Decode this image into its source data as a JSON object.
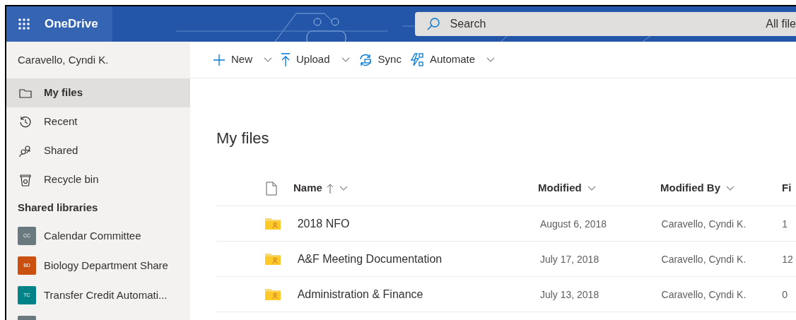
{
  "header": {
    "app_name": "OneDrive",
    "search": {
      "placeholder": "Search",
      "scope": "All file"
    }
  },
  "sidebar": {
    "user": "Caravello, Cyndi K.",
    "items": [
      {
        "label": "My files",
        "kind": "folder",
        "selected": true
      },
      {
        "label": "Recent",
        "kind": "recent",
        "selected": false
      },
      {
        "label": "Shared",
        "kind": "shared",
        "selected": false
      },
      {
        "label": "Recycle bin",
        "kind": "bin",
        "selected": false
      }
    ],
    "section": "Shared libraries",
    "libraries": [
      {
        "initials": "CC",
        "label": "Calendar Committee",
        "color": "#69797e"
      },
      {
        "initials": "BD",
        "label": "Biology Department Share",
        "color": "#ca5010"
      },
      {
        "initials": "TC",
        "label": "Transfer Credit Automati...",
        "color": "#038387"
      },
      {
        "color": "#69797e"
      }
    ]
  },
  "toolbar": [
    {
      "label": "New",
      "kind": "plus",
      "menu": true
    },
    {
      "label": "Upload",
      "kind": "upload",
      "menu": true
    },
    {
      "label": "Sync",
      "kind": "sync",
      "menu": false
    },
    {
      "label": "Automate",
      "kind": "automate",
      "menu": true
    }
  ],
  "title": "My files",
  "table": {
    "columns": [
      {
        "label": "Name",
        "sorted": true
      },
      {
        "label": "Modified",
        "sorted": false
      },
      {
        "label": "Modified By",
        "sorted": false
      },
      {
        "label": "Fi",
        "sorted": false
      }
    ],
    "rows": [
      {
        "name": "2018 NFO",
        "modified": "August 6, 2018",
        "modified_by": "Caravello, Cyndi K.",
        "column_5": "1"
      },
      {
        "name": "A&F Meeting Documentation",
        "modified": "July 17, 2018",
        "modified_by": "Caravello, Cyndi K.",
        "column_5": "12"
      },
      {
        "name": "Administration & Finance",
        "modified": "July 13, 2018",
        "modified_by": "Caravello, Cyndi K.",
        "column_5": "0"
      }
    ]
  }
}
